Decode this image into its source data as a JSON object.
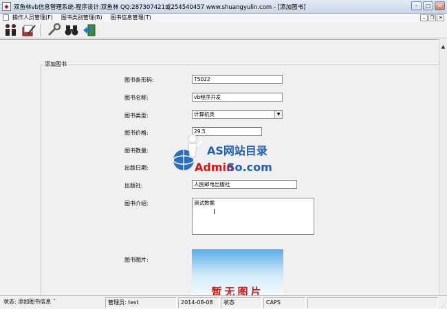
{
  "window": {
    "title": "双鱼林vb信息管理系统-程序设计:双鱼林 QQ:287307421或254540457 www.shuangyulin.com - [添加图书]",
    "buttons": {
      "minimize": "–",
      "maximize": "□",
      "close": "✕"
    }
  },
  "menu": {
    "items": [
      "操作人员管理(F)",
      "图书类别管理(B)",
      "图书信息管理(T)"
    ],
    "mdi_buttons": {
      "minimize": "–",
      "restore": "❐",
      "close": "✕"
    }
  },
  "toolbar": {
    "icons": [
      "users-icon",
      "edit-icon",
      "tools-icon",
      "binoculars-icon",
      "exit-icon"
    ]
  },
  "form": {
    "group_title": "添加图书",
    "labels": {
      "barcode": "图书条形码:",
      "name": "图书名称:",
      "type": "图书类型:",
      "price": "图书价格:",
      "count": "图书数量:",
      "publish_date": "出版日期:",
      "publisher": "出版社:",
      "intro": "图书介绍:",
      "image": "图书图片:"
    },
    "values": {
      "barcode": "TS022",
      "name": "vb程序开发",
      "type": "计算机类",
      "price": "29.5",
      "publisher": "人民邮电出版社",
      "intro": "测试数据"
    },
    "image_placeholder": "暂无图片"
  },
  "watermark": {
    "line1": "AS网站目录",
    "line2_red": "Admin",
    "line2_blue": "So.com"
  },
  "status": {
    "message": "状态:   添加图书信息 ˝",
    "operator": "管理员: test",
    "date": "2014-08-08",
    "mode": "状态",
    "caps": "CAPS"
  },
  "colors": {
    "title_gradient_top": "#e3eaf3",
    "watermark_blue": "#1e5fb8",
    "watermark_red": "#d41515",
    "image_sky": "#5aaee6"
  }
}
